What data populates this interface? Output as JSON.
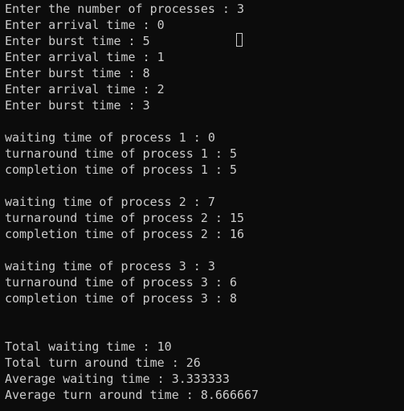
{
  "terminal": {
    "lines": [
      "Enter the number of processes : 3",
      "Enter arrival time : 0",
      "Enter burst time : 5",
      "Enter arrival time : 1",
      "Enter burst time : 8",
      "Enter arrival time : 2",
      "Enter burst time : 3",
      "",
      "waiting time of process 1 : 0",
      "turnaround time of process 1 : 5",
      "completion time of process 1 : 5",
      "",
      "waiting time of process 2 : 7",
      "turnaround time of process 2 : 15",
      "completion time of process 2 : 16",
      "",
      "waiting time of process 3 : 3",
      "turnaround time of process 3 : 6",
      "completion time of process 3 : 8",
      "",
      "",
      "Total waiting time : 10",
      "Total turn around time : 26",
      "Average waiting time : 3.333333",
      "Average turn around time : 8.666667"
    ]
  },
  "colors": {
    "background": "#0c0c0c",
    "foreground": "#cccccc"
  }
}
